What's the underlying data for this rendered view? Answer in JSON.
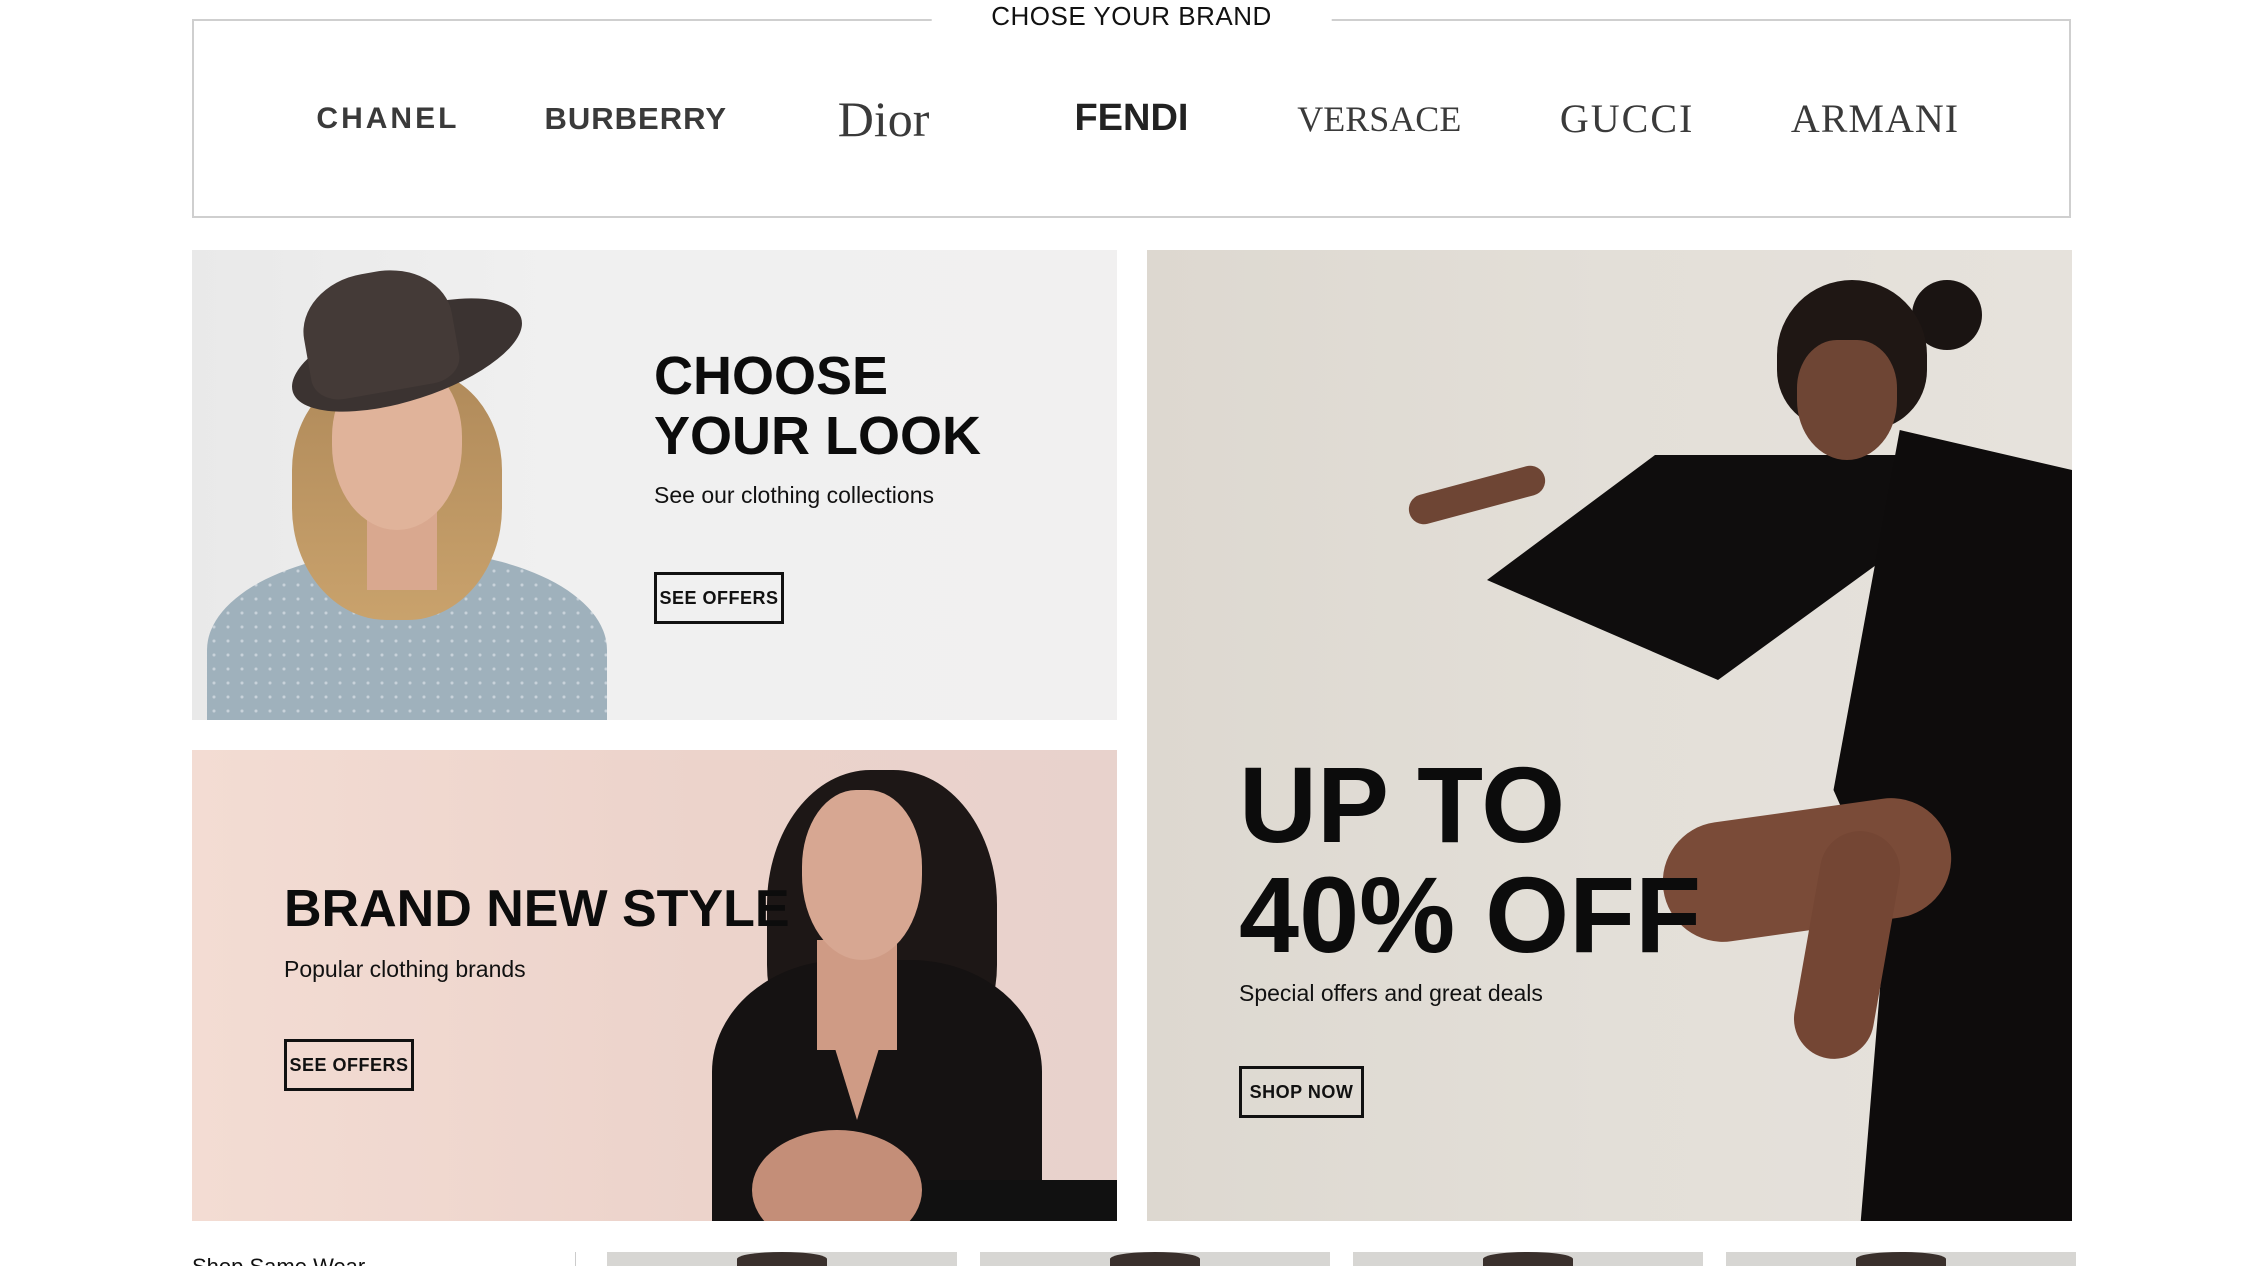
{
  "brands": {
    "title": "CHOSE YOUR BRAND",
    "logos": [
      "CHANEL",
      "BURBERRY",
      "Dior",
      "FENDI",
      "VERSACE",
      "GUCCI",
      "ARMANI"
    ]
  },
  "banners": {
    "look": {
      "headline": "CHOOSE YOUR LOOK",
      "subtitle": "See our clothing collections",
      "cta": "SEE OFFERS"
    },
    "style": {
      "headline": "BRAND NEW STYLE",
      "subtitle": "Popular clothing brands",
      "cta": "SEE OFFERS"
    },
    "sale": {
      "headline": "UP TO 40% OFF",
      "subtitle": "Special offers and great deals",
      "cta": "SHOP NOW"
    }
  },
  "bottom": {
    "heading": "Shop Same Wear"
  }
}
